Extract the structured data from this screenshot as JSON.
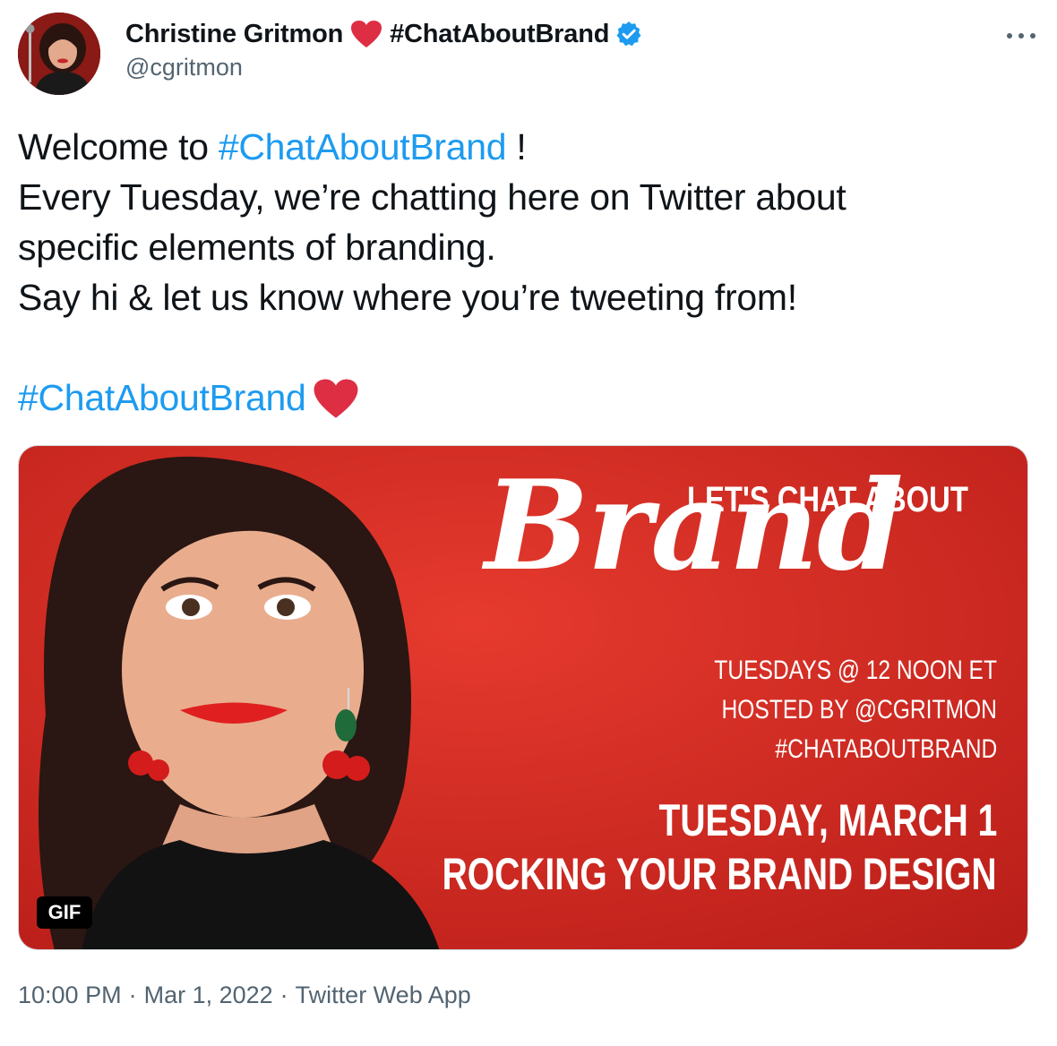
{
  "author": {
    "display_name": "Christine Gritmon",
    "name_tag": "#ChatAboutBrand",
    "handle": "@cgritmon",
    "verified": true,
    "avatar": "avatar-photo"
  },
  "tweet": {
    "line1_prefix": "Welcome to ",
    "line1_hashtag": "#ChatAboutBrand",
    "line1_suffix": " !",
    "line2": "Every Tuesday, we’re chatting here on Twitter about",
    "line3": "specific elements of branding.",
    "line4": "Say hi & let us know where you’re tweeting from!",
    "closing_hashtag": "#ChatAboutBrand"
  },
  "media": {
    "badge": "GIF",
    "lets_chat": "LET'S CHAT ABOUT",
    "brand_word": "Brand",
    "schedule_line1": "TUESDAYS @ 12 NOON ET",
    "schedule_line2": "HOSTED BY @CGRITMON",
    "schedule_line3": "#CHATABOUTBRAND",
    "date_line": "TUESDAY, MARCH 1",
    "topic_line": "ROCKING YOUR BRAND DESIGN"
  },
  "footer": {
    "time": "10:00 PM",
    "date": "Mar 1, 2022",
    "source": "Twitter Web App",
    "separator": "·"
  },
  "colors": {
    "link": "#1d9bf0",
    "heart": "#dd2e44",
    "verified": "#1d9bf0",
    "media_red": "#d6271f",
    "muted_text": "#536471"
  },
  "icons": {
    "more": "more-icon",
    "heart": "heart-icon",
    "verified": "verified-badge-icon"
  }
}
